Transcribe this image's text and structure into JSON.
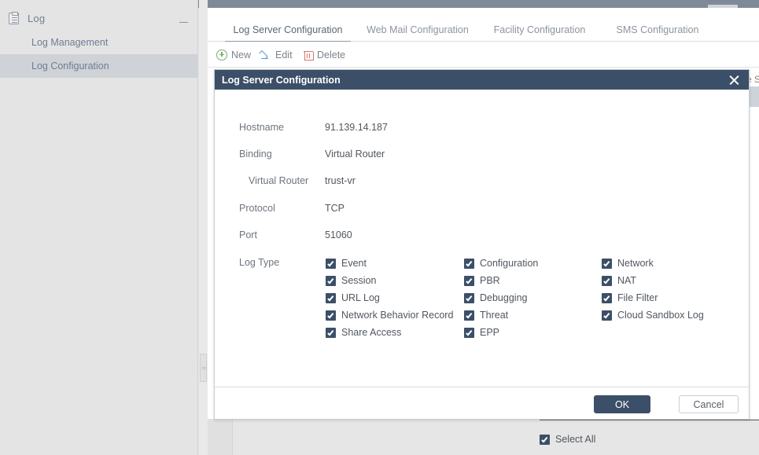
{
  "sidebar": {
    "title": "Log",
    "icon": "clipboard-icon",
    "collapse_icon": "minimize-icon",
    "items": [
      {
        "label": "Log Management",
        "selected": false
      },
      {
        "label": "Log Configuration",
        "selected": true
      }
    ]
  },
  "tabs": [
    {
      "label": "Log Server Configuration",
      "active": true
    },
    {
      "label": "Web Mail Configuration",
      "active": false
    },
    {
      "label": "Facility Configuration",
      "active": false
    },
    {
      "label": "SMS Configuration",
      "active": false
    }
  ],
  "toolbar": {
    "new_label": "New",
    "edit_label": "Edit",
    "delete_label": "Delete"
  },
  "background": {
    "clipped_header_text": "e S"
  },
  "dialog": {
    "title": "Log Server Configuration",
    "close_icon": "close-icon",
    "fields": [
      {
        "label": "Hostname",
        "value": "91.139.14.187",
        "indent": false
      },
      {
        "label": "Binding",
        "value": "Virtual Router",
        "indent": false
      },
      {
        "label": "Virtual Router",
        "value": "trust-vr",
        "indent": true
      },
      {
        "label": "Protocol",
        "value": "TCP",
        "indent": false
      },
      {
        "label": "Port",
        "value": "51060",
        "indent": false
      }
    ],
    "log_type_label": "Log Type",
    "log_types": [
      {
        "label": "Event",
        "checked": true,
        "col": 0,
        "row": 0
      },
      {
        "label": "Session",
        "checked": true,
        "col": 0,
        "row": 1
      },
      {
        "label": "URL Log",
        "checked": true,
        "col": 0,
        "row": 2
      },
      {
        "label": "Network Behavior Record",
        "checked": true,
        "col": 0,
        "row": 3
      },
      {
        "label": "Share Access",
        "checked": true,
        "col": 0,
        "row": 4
      },
      {
        "label": "Configuration",
        "checked": true,
        "col": 1,
        "row": 0
      },
      {
        "label": "PBR",
        "checked": true,
        "col": 1,
        "row": 1
      },
      {
        "label": "Debugging",
        "checked": true,
        "col": 1,
        "row": 2
      },
      {
        "label": "Threat",
        "checked": true,
        "col": 1,
        "row": 3
      },
      {
        "label": "EPP",
        "checked": true,
        "col": 1,
        "row": 4
      },
      {
        "label": "Network",
        "checked": true,
        "col": 2,
        "row": 0
      },
      {
        "label": "NAT",
        "checked": true,
        "col": 2,
        "row": 1
      },
      {
        "label": "File Filter",
        "checked": true,
        "col": 2,
        "row": 2
      },
      {
        "label": "Cloud Sandbox Log",
        "checked": true,
        "col": 2,
        "row": 3
      }
    ],
    "select_all": {
      "label": "Select All",
      "checked": true
    },
    "ok_label": "OK",
    "cancel_label": "Cancel"
  },
  "colors": {
    "accent_dark": "#3c4f68",
    "topbar": "#7f8a99",
    "sidebar_bg": "#e4e4e4",
    "sidebar_selected": "#cfd2d6"
  }
}
